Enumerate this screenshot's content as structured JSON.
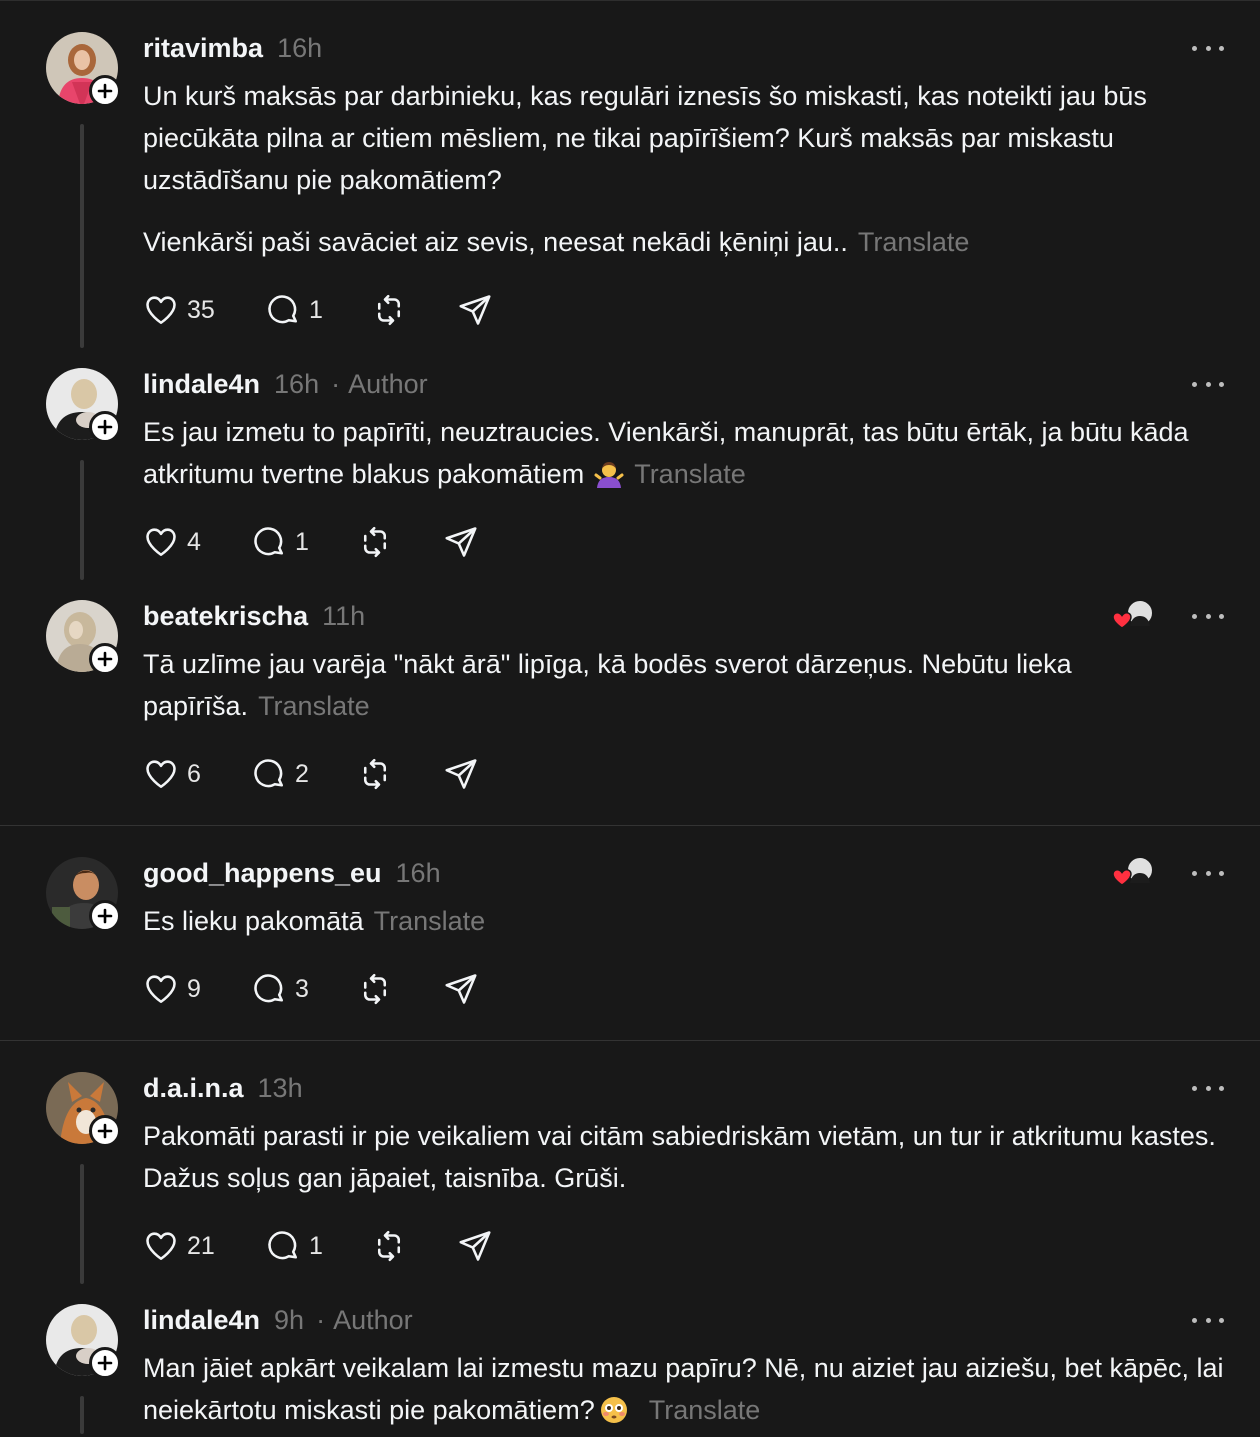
{
  "translate_label": "Translate",
  "author_label": "Author",
  "posts": [
    {
      "username": "ritavimba",
      "time": "16h",
      "paragraphs": [
        "Un kurš maksās par darbinieku, kas regulāri iznesīs šo miskasti, kas noteikti jau būs piecūkāta pilna ar citiem mēsliem, ne tikai papīrīšiem? Kurš maksās par miskastu uzstādīšanu pie pakomātiem?",
        "Vienkārši paši savāciet aiz sevis, neesat nekādi ķēniņi jau.."
      ],
      "likes": "35",
      "replies": "1",
      "avatar_icon": "woman-pink-coat-avatar",
      "accent_color": "#e8456b"
    },
    {
      "username": "lindale4n",
      "time": "16h",
      "is_author": true,
      "paragraphs": [
        "Es jau izmetu to papīrīti, neuztraucies. Vienkārši, manuprāt, tas būtu ērtāk, ja būtu kāda atkritumu tvertne blakus pakomātiem"
      ],
      "emoji": "person-shrugging-emoji",
      "likes": "4",
      "replies": "1"
    },
    {
      "username": "beatekrischa",
      "time": "11h",
      "liked_by_author": true,
      "paragraphs": [
        "Tā uzlīme jau varēja \"nākt ārā\" lipīga, kā bodēs sverot dārzeņus. Nebūtu lieka papīrīša."
      ],
      "likes": "6",
      "replies": "2"
    },
    {
      "username": "good_happens_eu",
      "time": "16h",
      "liked_by_author": true,
      "paragraphs": [
        "Es lieku pakomātā"
      ],
      "likes": "9",
      "replies": "3"
    },
    {
      "username": "d.a.i.n.a",
      "time": "13h",
      "paragraphs": [
        "Pakomāti parasti ir pie veikaliem vai citām sabiedriskām vietām, un tur ir atkritumu kastes. Dažus soļus gan jāpaiet, taisnība. Grūši."
      ],
      "likes": "21",
      "replies": "1"
    },
    {
      "username": "lindale4n",
      "time": "9h",
      "is_author": true,
      "paragraphs": [
        "Man jāiet apkārt veikalam lai izmestu mazu papīru? Nē, nu aiziet jau aiziešu, bet kāpēc, lai neiekārtotu miskasti pie pakomātiem?"
      ],
      "emoji": "flushed-face-emoji"
    }
  ],
  "colors": {
    "background": "#181818",
    "text": "#f3f5f7",
    "muted": "#777777",
    "heart_red": "#ff3040"
  }
}
